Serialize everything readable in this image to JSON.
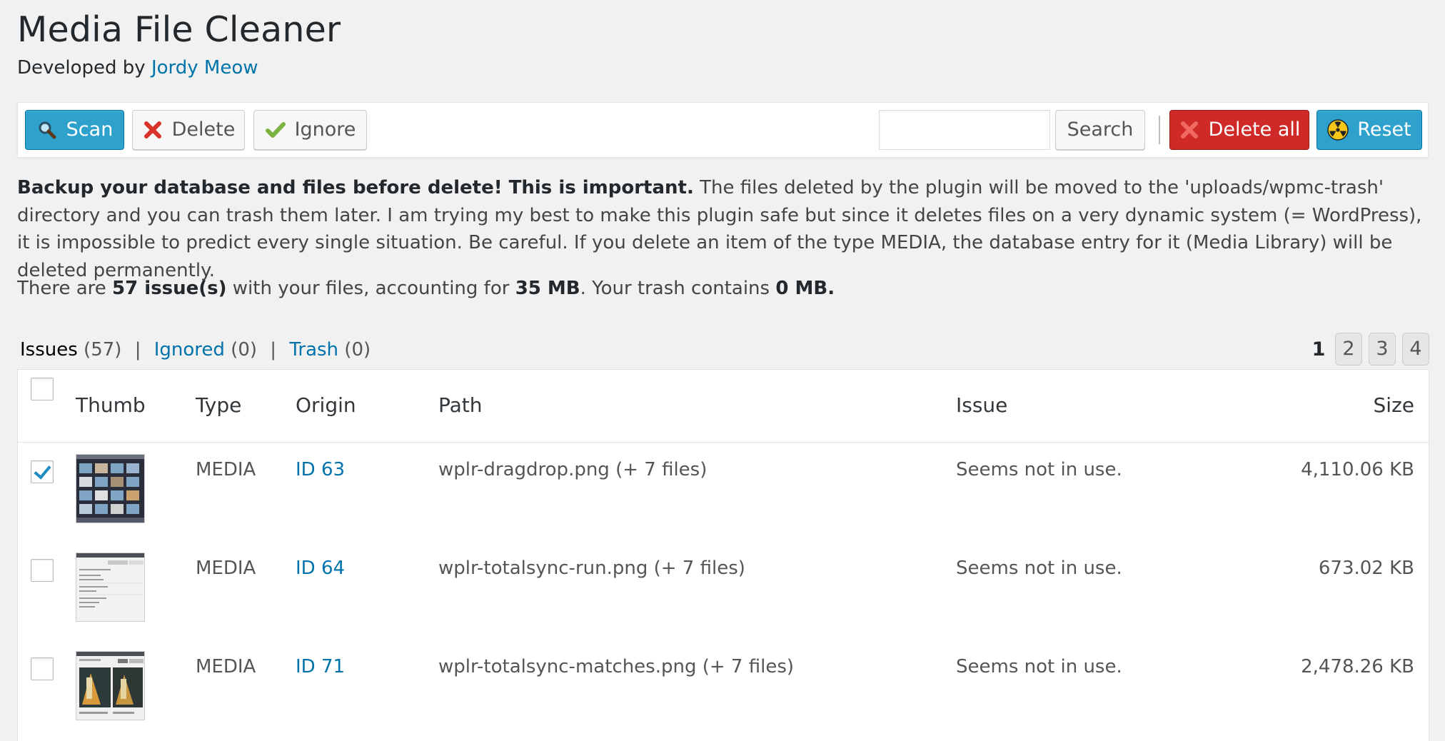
{
  "header": {
    "title": "Media File Cleaner",
    "developed_by_prefix": "Developed by",
    "author": "Jordy Meow"
  },
  "toolbar": {
    "scan": "Scan",
    "delete": "Delete",
    "ignore": "Ignore",
    "search_value": "",
    "search_button": "Search",
    "delete_all": "Delete all",
    "reset": "Reset"
  },
  "notice": {
    "bold": "Backup your database and files before delete! This is important.",
    "text": " The files deleted by the plugin will be moved to the 'uploads/wpmc-trash' directory and you can trash them later. I am trying my best to make this plugin safe but since it deletes files on a very dynamic system (= WordPress), it is impossible to predict every single situation. Be careful. If you delete an item of the type MEDIA, the database entry for it (Media Library) will be deleted permanently."
  },
  "stats": {
    "prefix": "There are ",
    "issues": "57 issue(s)",
    "middle": " with your files, accounting for ",
    "size": "35 MB",
    "trash_prefix": ". Your trash contains ",
    "trash": "0 MB."
  },
  "views": [
    {
      "label": "Issues",
      "count": "(57)"
    },
    {
      "label": "Ignored",
      "count": "(0)"
    },
    {
      "label": "Trash",
      "count": "(0)"
    }
  ],
  "pagination": {
    "current": "1",
    "pages": [
      "2",
      "3",
      "4"
    ]
  },
  "table": {
    "columns": [
      "Thumb",
      "Type",
      "Origin",
      "Path",
      "Issue",
      "Size"
    ],
    "rows": [
      {
        "checked": true,
        "type": "MEDIA",
        "origin": "ID 63",
        "path": "wplr-dragdrop.png (+ 7 files)",
        "issue": "Seems not in use.",
        "size": "4,110.06 KB"
      },
      {
        "checked": false,
        "type": "MEDIA",
        "origin": "ID 64",
        "path": "wplr-totalsync-run.png (+ 7 files)",
        "issue": "Seems not in use.",
        "size": "673.02 KB"
      },
      {
        "checked": false,
        "type": "MEDIA",
        "origin": "ID 71",
        "path": "wplr-totalsync-matches.png (+ 7 files)",
        "issue": "Seems not in use.",
        "size": "2,478.26 KB"
      }
    ]
  },
  "icons": {
    "scan": "magnifier-icon",
    "delete": "red-x-icon",
    "ignore": "green-check-icon",
    "delete_all": "red-x-icon",
    "reset": "radiation-icon"
  },
  "colors": {
    "primary": "#2ea2cc",
    "danger": "#cf2a27",
    "link": "#0073aa"
  }
}
